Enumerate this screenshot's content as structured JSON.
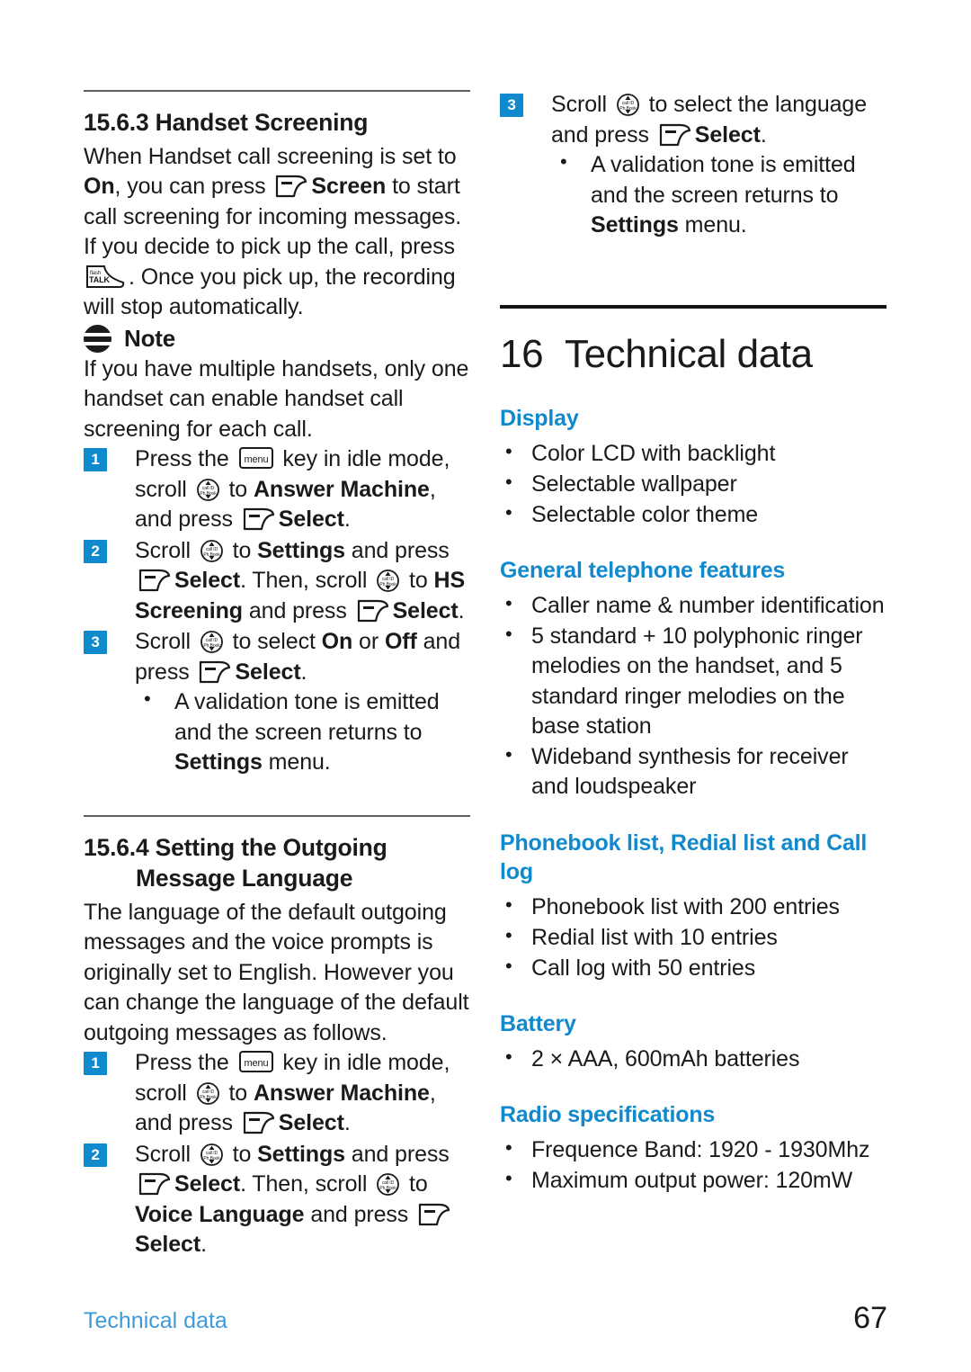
{
  "page": {
    "footer_label": "Technical data",
    "page_number": "67"
  },
  "left_column": {
    "section_1": {
      "heading": "15.6.3 Handset Screening",
      "intro_parts": {
        "p1": "When Handset call screening is set to ",
        "on": "On",
        "p2": ", you can press ",
        "screen": "Screen",
        "p3": " to start call screening for incoming messages. If you decide to pick up the call, press ",
        "p4": ". Once you pick up, the recording will stop automatically."
      },
      "note": {
        "label": "Note",
        "text": "If you have multiple handsets, only one handset can enable handset call screening for each call."
      },
      "steps": [
        {
          "num": "1",
          "parts": {
            "a": "Press the ",
            "b": " key in idle mode, scroll ",
            "c": " to ",
            "d": "Answer Machine",
            "e": ", and press ",
            "f": "Select",
            "g": "."
          }
        },
        {
          "num": "2",
          "parts": {
            "a": "Scroll ",
            "b": " to ",
            "c": "Settings",
            "d": " and press ",
            "e": "Select",
            "f": ". Then, scroll ",
            "g": " to ",
            "h": "HS Screening",
            "i": " and press ",
            "j": "Select",
            "k": "."
          }
        },
        {
          "num": "3",
          "parts": {
            "a": "Scroll ",
            "b": " to select ",
            "c": "On",
            "d": " or ",
            "e": "Off",
            "f": " and press ",
            "g": "Select",
            "h": "."
          },
          "sub_bullets": [
            {
              "a": "A validation tone is emitted and the screen returns to ",
              "b": "Settings",
              "c": " menu."
            }
          ]
        }
      ]
    },
    "section_2": {
      "heading_line1": "15.6.4 Setting the Outgoing",
      "heading_line2": "Message Language",
      "intro": "The language of the default outgoing messages and the voice prompts is originally set to English. However you can change the language of the default outgoing messages as follows.",
      "steps": [
        {
          "num": "1",
          "parts": {
            "a": "Press the ",
            "b": " key in idle mode, scroll ",
            "c": " to ",
            "d": "Answer Machine",
            "e": ", and press ",
            "f": "Select",
            "g": "."
          }
        },
        {
          "num": "2",
          "parts": {
            "a": "Scroll ",
            "b": " to ",
            "c": "Settings",
            "d": " and press ",
            "e": "Select",
            "f": ". Then, scroll ",
            "g": " to ",
            "h": "Voice Language",
            "i": " and press ",
            "j": "Select",
            "k": "."
          }
        }
      ]
    }
  },
  "right_column": {
    "step_3": {
      "num": "3",
      "parts": {
        "a": "Scroll ",
        "b": " to select the language and press ",
        "c": "Select",
        "d": "."
      },
      "sub_bullets": [
        {
          "a": "A validation tone is emitted and the screen returns to ",
          "b": "Settings",
          "c": " menu."
        }
      ]
    },
    "chapter": {
      "number": "16",
      "title": "Technical data"
    },
    "spec_sections": [
      {
        "heading": "Display",
        "items": [
          "Color LCD with backlight",
          "Selectable wallpaper",
          "Selectable color theme"
        ]
      },
      {
        "heading": "General telephone features",
        "items": [
          "Caller name & number identification",
          "5 standard + 10 polyphonic ringer melodies on the handset, and 5 standard ringer melodies on the base station",
          "Wideband synthesis for receiver and loudspeaker"
        ]
      },
      {
        "heading": "Phonebook list, Redial list and Call log",
        "items": [
          "Phonebook list with 200 entries",
          "Redial list with 10 entries",
          "Call log with 50 entries"
        ]
      },
      {
        "heading": "Battery",
        "items": [
          "2 × AAA, 600mAh batteries"
        ]
      },
      {
        "heading": "Radio specifications",
        "items": [
          "Frequence Band: 1920 - 1930Mhz",
          "Maximum output power: 120mW"
        ]
      }
    ]
  },
  "icons": {
    "soft_key": "soft-key-icon",
    "nav_key": "nav-scroll-key-icon",
    "menu_key": "menu-key-icon",
    "talk_key": "talk-key-icon",
    "note": "note-icon"
  },
  "colors": {
    "accent_blue": "#1189cd",
    "footer_blue": "#3f9ad8",
    "text": "#1a1a1a"
  }
}
